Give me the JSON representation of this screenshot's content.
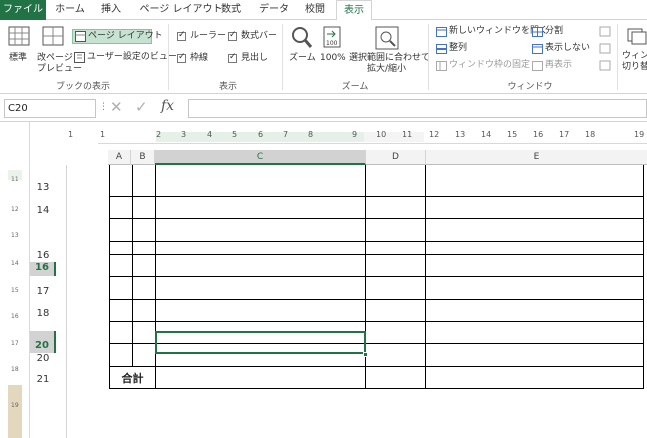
{
  "tabs": [
    "ファイル",
    "ホーム",
    "挿入",
    "ページ レイアウト",
    "数式",
    "データ",
    "校閲",
    "表示"
  ],
  "ribbon": {
    "workbook_views": {
      "normal": "標準",
      "page_break": [
        "改ページ",
        "プレビュー"
      ],
      "page_layout": "ページ レイアウト",
      "custom_views": "ユーザー設定のビュー",
      "label": "ブックの表示"
    },
    "show": {
      "ruler": "ルーラー",
      "formula_bar": "数式バー",
      "gridlines": "枠線",
      "headings": "見出し",
      "label": "表示"
    },
    "zoom": {
      "zoom": "ズーム",
      "hundred": "100%",
      "selection": [
        "選択範囲に合わせて",
        "拡大/縮小"
      ],
      "label": "ズーム"
    },
    "window": {
      "new_window": "新しいウィンドウを開く",
      "arrange": "整列",
      "freeze": "ウィンドウ枠の固定 ▾",
      "split": "分割",
      "hide": "表示しない",
      "unhide": "再表示",
      "switch": [
        "ウィンド",
        "切り替"
      ],
      "label": "ウィンドウ"
    }
  },
  "formula_bar": {
    "name_box": "C20",
    "fx": "fx",
    "value": ""
  },
  "ruler_numbers": [
    "1",
    "1",
    "2",
    "3",
    "4",
    "5",
    "6",
    "7",
    "8",
    "9",
    "10",
    "11",
    "12",
    "13",
    "14",
    "15",
    "16",
    "17",
    "18",
    "19"
  ],
  "vruler_numbers": [
    "11",
    "12",
    "13",
    "14",
    "15",
    "16",
    "17",
    "18",
    "19"
  ],
  "columns": [
    "A",
    "B",
    "C",
    "D",
    "E"
  ],
  "rows": [
    "13",
    "14",
    "16",
    "17",
    "18",
    "20",
    "20",
    "21"
  ],
  "cells": {
    "total_label": "合計"
  },
  "colors": {
    "accent": "#217346",
    "selected_header": "#d2d2d2"
  }
}
